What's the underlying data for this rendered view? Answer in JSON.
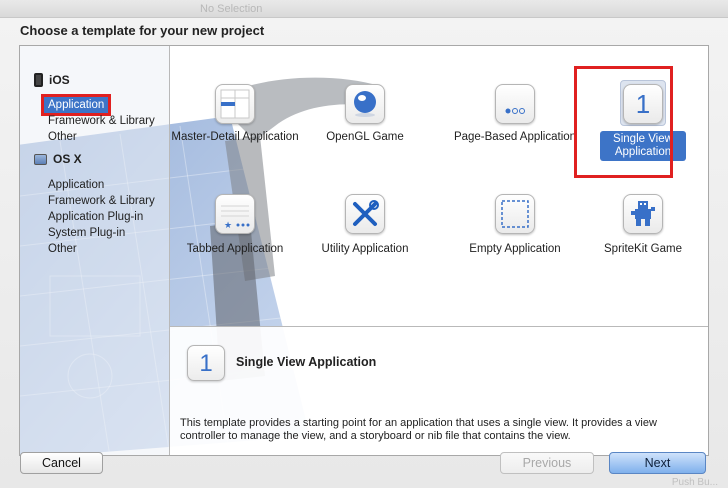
{
  "window": {
    "ghost_title": "No Selection",
    "bottom_ghost": "Push Bu..."
  },
  "sheet": {
    "title": "Choose a template for your new project"
  },
  "sidebar": {
    "categories": [
      {
        "name": "iOS",
        "items": [
          "Application",
          "Framework & Library",
          "Other"
        ]
      },
      {
        "name": "OS X",
        "items": [
          "Application",
          "Framework & Library",
          "Application Plug-in",
          "System Plug-in",
          "Other"
        ]
      }
    ],
    "selected": "Application"
  },
  "templates": [
    {
      "label": "Master-Detail Application",
      "icon": "master-detail-icon"
    },
    {
      "label": "OpenGL Game",
      "icon": "opengl-icon"
    },
    {
      "label": "Page-Based Application",
      "icon": "page-based-icon"
    },
    {
      "label": "Single View Application",
      "icon": "single-view-icon",
      "selected": true
    },
    {
      "label": "Tabbed Application",
      "icon": "tabbed-icon"
    },
    {
      "label": "Utility Application",
      "icon": "utility-icon"
    },
    {
      "label": "Empty Application",
      "icon": "empty-icon"
    },
    {
      "label": "SpriteKit Game",
      "icon": "spritekit-icon"
    }
  ],
  "description": {
    "icon_glyph": "1",
    "title": "Single View Application",
    "text": "This template provides a starting point for an application that uses a single view. It provides a view controller to manage the view, and a storyboard or nib file that contains the view."
  },
  "buttons": {
    "cancel": "Cancel",
    "previous": "Previous",
    "next": "Next"
  },
  "colors": {
    "selection": "#3d74c7",
    "highlight_annotation": "#e02020",
    "icon_accent": "#3870c8"
  }
}
